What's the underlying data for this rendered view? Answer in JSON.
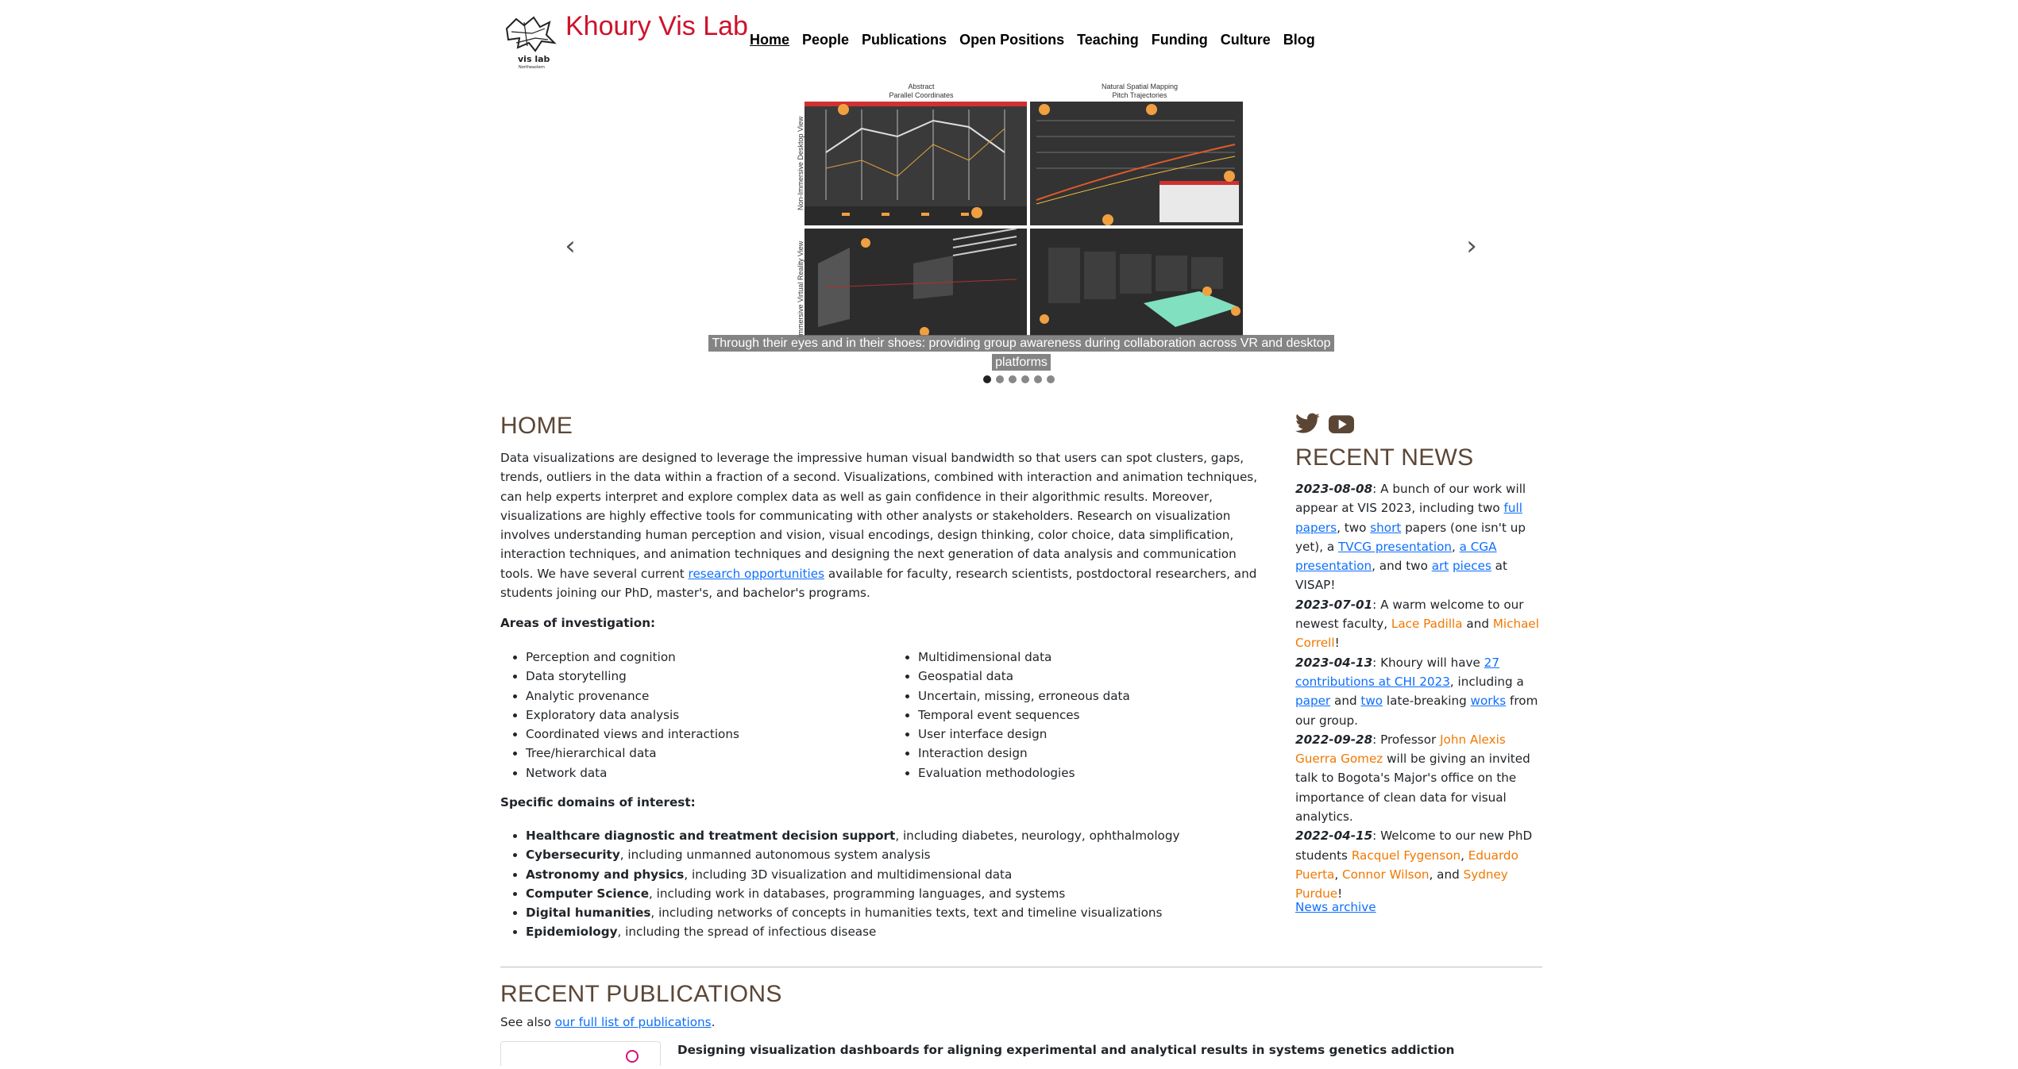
{
  "header": {
    "logo_text": "vis lab",
    "logo_subtext": "Northeastern",
    "site_title": "Khoury Vis Lab",
    "nav": [
      {
        "label": "Home",
        "active": true
      },
      {
        "label": "People"
      },
      {
        "label": "Publications"
      },
      {
        "label": "Open Positions"
      },
      {
        "label": "Teaching"
      },
      {
        "label": "Funding"
      },
      {
        "label": "Culture"
      },
      {
        "label": "Blog"
      }
    ]
  },
  "carousel": {
    "col_labels": [
      "Abstract\nParallel Coordinates",
      "Natural Spatial Mapping\nPitch Trajectories"
    ],
    "row_labels": [
      "Non-Immersive Desktop View",
      "Immersive Virtual Reality View"
    ],
    "caption": "Through their eyes and in their shoes: providing group awareness during collaboration across VR and desktop platforms",
    "slide_count": 6,
    "active_index": 0,
    "prev_icon": "chevron-left-icon",
    "next_icon": "chevron-right-icon"
  },
  "home": {
    "title": "HOME",
    "intro_before_link": "Data visualizations are designed to leverage the impressive human visual bandwidth so that users can spot clusters, gaps, trends, outliers in the data within a fraction of a second. Visualizations, combined with interaction and animation techniques, can help experts interpret and explore complex data as well as gain confidence in their algorithmic results. Moreover, visualizations are highly effective tools for communicating with other analysts or stakeholders. Research on visualization involves understanding human perception and vision, visual encodings, design thinking, color choice, data simplification, interaction techniques, and animation techniques and designing the next generation of data analysis and communication tools. We have several current ",
    "intro_link": "research opportunities",
    "intro_after_link": " available for faculty, research scientists, postdoctoral researchers, and students joining our PhD, master's, and bachelor's programs.",
    "areas_heading": "Areas of investigation:",
    "areas_left": [
      "Perception and cognition",
      "Data storytelling",
      "Analytic provenance",
      "Exploratory data analysis",
      "Coordinated views and interactions",
      "Tree/hierarchical data",
      "Network data"
    ],
    "areas_right": [
      "Multidimensional data",
      "Geospatial data",
      "Uncertain, missing, erroneous data",
      "Temporal event sequences",
      "User interface design",
      "Interaction design",
      "Evaluation methodologies"
    ],
    "domains_heading": "Specific domains of interest:",
    "domains": [
      {
        "bold": "Healthcare diagnostic and treatment decision support",
        "rest": ", including diabetes, neurology, ophthalmology"
      },
      {
        "bold": "Cybersecurity",
        "rest": ", including unmanned autonomous system analysis"
      },
      {
        "bold": "Astronomy and physics",
        "rest": ", including 3D visualization and multidimensional data"
      },
      {
        "bold": "Computer Science",
        "rest": ", including work in databases, programming languages, and systems"
      },
      {
        "bold": "Digital humanities",
        "rest": ", including networks of concepts in humanities texts, text and timeline visualizations"
      },
      {
        "bold": "Epidemiology",
        "rest": ", including the spread of infectious disease"
      }
    ]
  },
  "sidebar": {
    "social_icons": [
      "twitter-icon",
      "youtube-icon"
    ],
    "news_title": "RECENT NEWS",
    "news": [
      {
        "date": "2023-08-08",
        "parts": [
          ": A bunch of our work will appear at VIS 2023, including two ",
          {
            "link": "full papers"
          },
          ", two ",
          {
            "link": "short"
          },
          " papers (one isn't up yet), a ",
          {
            "link": "TVCG presentation"
          },
          ", ",
          {
            "link": "a CGA presentation"
          },
          ", and two ",
          {
            "link": "art"
          },
          " ",
          {
            "link": "pieces"
          },
          " at VISAP!"
        ]
      },
      {
        "date": "2023-07-01",
        "parts": [
          ": A warm welcome to our newest faculty, ",
          {
            "person": "Lace Padilla"
          },
          " and ",
          {
            "person": "Michael Correll"
          },
          "!"
        ]
      },
      {
        "date": "2023-04-13",
        "parts": [
          ": Khoury will have ",
          {
            "link": "27 contributions at CHI 2023"
          },
          ", including a ",
          {
            "link": "paper"
          },
          " and ",
          {
            "link": "two"
          },
          " late-breaking ",
          {
            "link": "works"
          },
          " from our group."
        ]
      },
      {
        "date": "2022-09-28",
        "parts": [
          ": Professor ",
          {
            "person": "John Alexis Guerra Gomez"
          },
          " will be giving an invited talk to Bogota's Major's office on the importance of clean data for visual analytics."
        ]
      },
      {
        "date": "2022-04-15",
        "parts": [
          ": Welcome to our new PhD students ",
          {
            "person": "Racquel Fygenson"
          },
          ", ",
          {
            "person": "Eduardo Puerta"
          },
          ", ",
          {
            "person": "Connor Wilson"
          },
          ", and ",
          {
            "person": "Sydney Purdue"
          },
          "!"
        ]
      }
    ],
    "news_archive": "News archive"
  },
  "publications": {
    "title": "RECENT PUBLICATIONS",
    "see_also_prefix": "See also ",
    "see_also_link": "our full list of publications",
    "see_also_suffix": ".",
    "first_title": "Designing visualization dashboards for aligning experimental and analytical results in systems genetics addiction"
  },
  "colors": {
    "brand_red": "#d0112b",
    "heading_brown": "#5b4636",
    "person_orange": "#f07800",
    "link_blue": "#0d6efd",
    "marker_orange": "#f0a040"
  }
}
